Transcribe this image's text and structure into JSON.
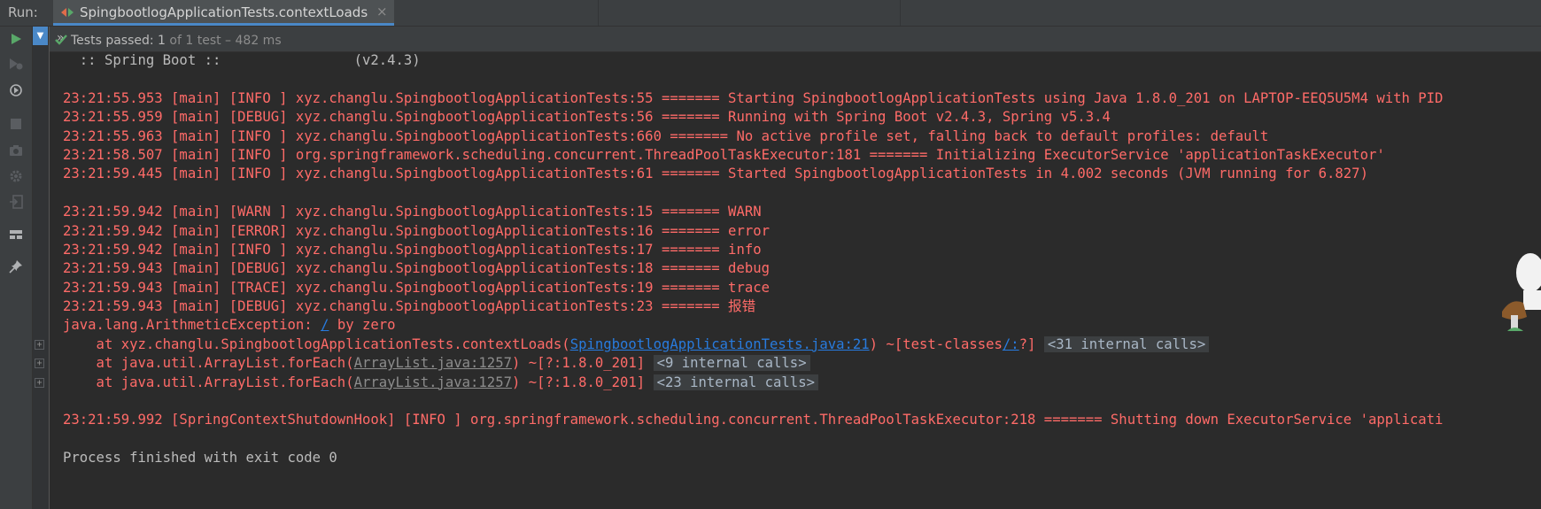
{
  "run_panel": {
    "label": "Run:",
    "tab_label": "SpingbootlogApplicationTests.contextLoads",
    "tab_close": "×"
  },
  "status": {
    "chevron": "»",
    "passed_label": "Tests passed:",
    "passed_count": "1",
    "detail": "of 1 test – 482 ms"
  },
  "console": {
    "banner": "  :: Spring Boot ::                (v2.4.3)",
    "lines_a": [
      "23:21:55.953 [main] [INFO ] xyz.changlu.SpingbootlogApplicationTests:55 ======= Starting SpingbootlogApplicationTests using Java 1.8.0_201 on LAPTOP-EEQ5U5M4 with PID",
      "23:21:55.959 [main] [DEBUG] xyz.changlu.SpingbootlogApplicationTests:56 ======= Running with Spring Boot v2.4.3, Spring v5.3.4",
      "23:21:55.963 [main] [INFO ] xyz.changlu.SpingbootlogApplicationTests:660 ======= No active profile set, falling back to default profiles: default",
      "23:21:58.507 [main] [INFO ] org.springframework.scheduling.concurrent.ThreadPoolTaskExecutor:181 ======= Initializing ExecutorService 'applicationTaskExecutor'",
      "23:21:59.445 [main] [INFO ] xyz.changlu.SpingbootlogApplicationTests:61 ======= Started SpingbootlogApplicationTests in 4.002 seconds (JVM running for 6.827)"
    ],
    "lines_b": [
      "23:21:59.942 [main] [WARN ] xyz.changlu.SpingbootlogApplicationTests:15 ======= WARN",
      "23:21:59.942 [main] [ERROR] xyz.changlu.SpingbootlogApplicationTests:16 ======= error",
      "23:21:59.942 [main] [INFO ] xyz.changlu.SpingbootlogApplicationTests:17 ======= info",
      "23:21:59.943 [main] [DEBUG] xyz.changlu.SpingbootlogApplicationTests:18 ======= debug",
      "23:21:59.943 [main] [TRACE] xyz.changlu.SpingbootlogApplicationTests:19 ======= trace",
      "23:21:59.943 [main] [DEBUG] xyz.changlu.SpingbootlogApplicationTests:23 ======= 报错"
    ],
    "exception": {
      "prefix": "java.lang.ArithmeticException: ",
      "link": "/",
      "suffix": " by zero"
    },
    "stack": [
      {
        "pre": "    at xyz.changlu.SpingbootlogApplicationTests.contextLoads(",
        "link": "SpingbootlogApplicationTests.java:21",
        "mid": ") ~[test-classes",
        "link2": "/:",
        "post": "?] ",
        "chip": "<31 internal calls>"
      },
      {
        "pre": "    at java.util.ArrayList.forEach(",
        "link": "ArrayList.java:1257",
        "post": ") ~[?:1.8.0_201] ",
        "chip": "<9 internal calls>"
      },
      {
        "pre": "    at java.util.ArrayList.forEach(",
        "link": "ArrayList.java:1257",
        "post": ") ~[?:1.8.0_201] ",
        "chip": "<23 internal calls>"
      }
    ],
    "shutdown": "23:21:59.992 [SpringContextShutdownHook] [INFO ] org.springframework.scheduling.concurrent.ThreadPoolTaskExecutor:218 ======= Shutting down ExecutorService 'applicati",
    "exit": "Process finished with exit code 0"
  },
  "colors": {
    "error_text": "#ff6b68",
    "standard_text": "#bbbbbb",
    "link": "#287bde",
    "pass_green": "#59a869",
    "accent_blue": "#4a88c7"
  },
  "icons": {
    "toolbar": [
      "rerun-icon",
      "rerun-failed-icon",
      "toggle-auto-test-icon",
      "stop-icon",
      "screenshot-icon",
      "settings-icon",
      "exit-icon",
      "layout-icon",
      "pin-icon"
    ],
    "gutter": [
      "fold-icon",
      "expand-icon"
    ]
  }
}
